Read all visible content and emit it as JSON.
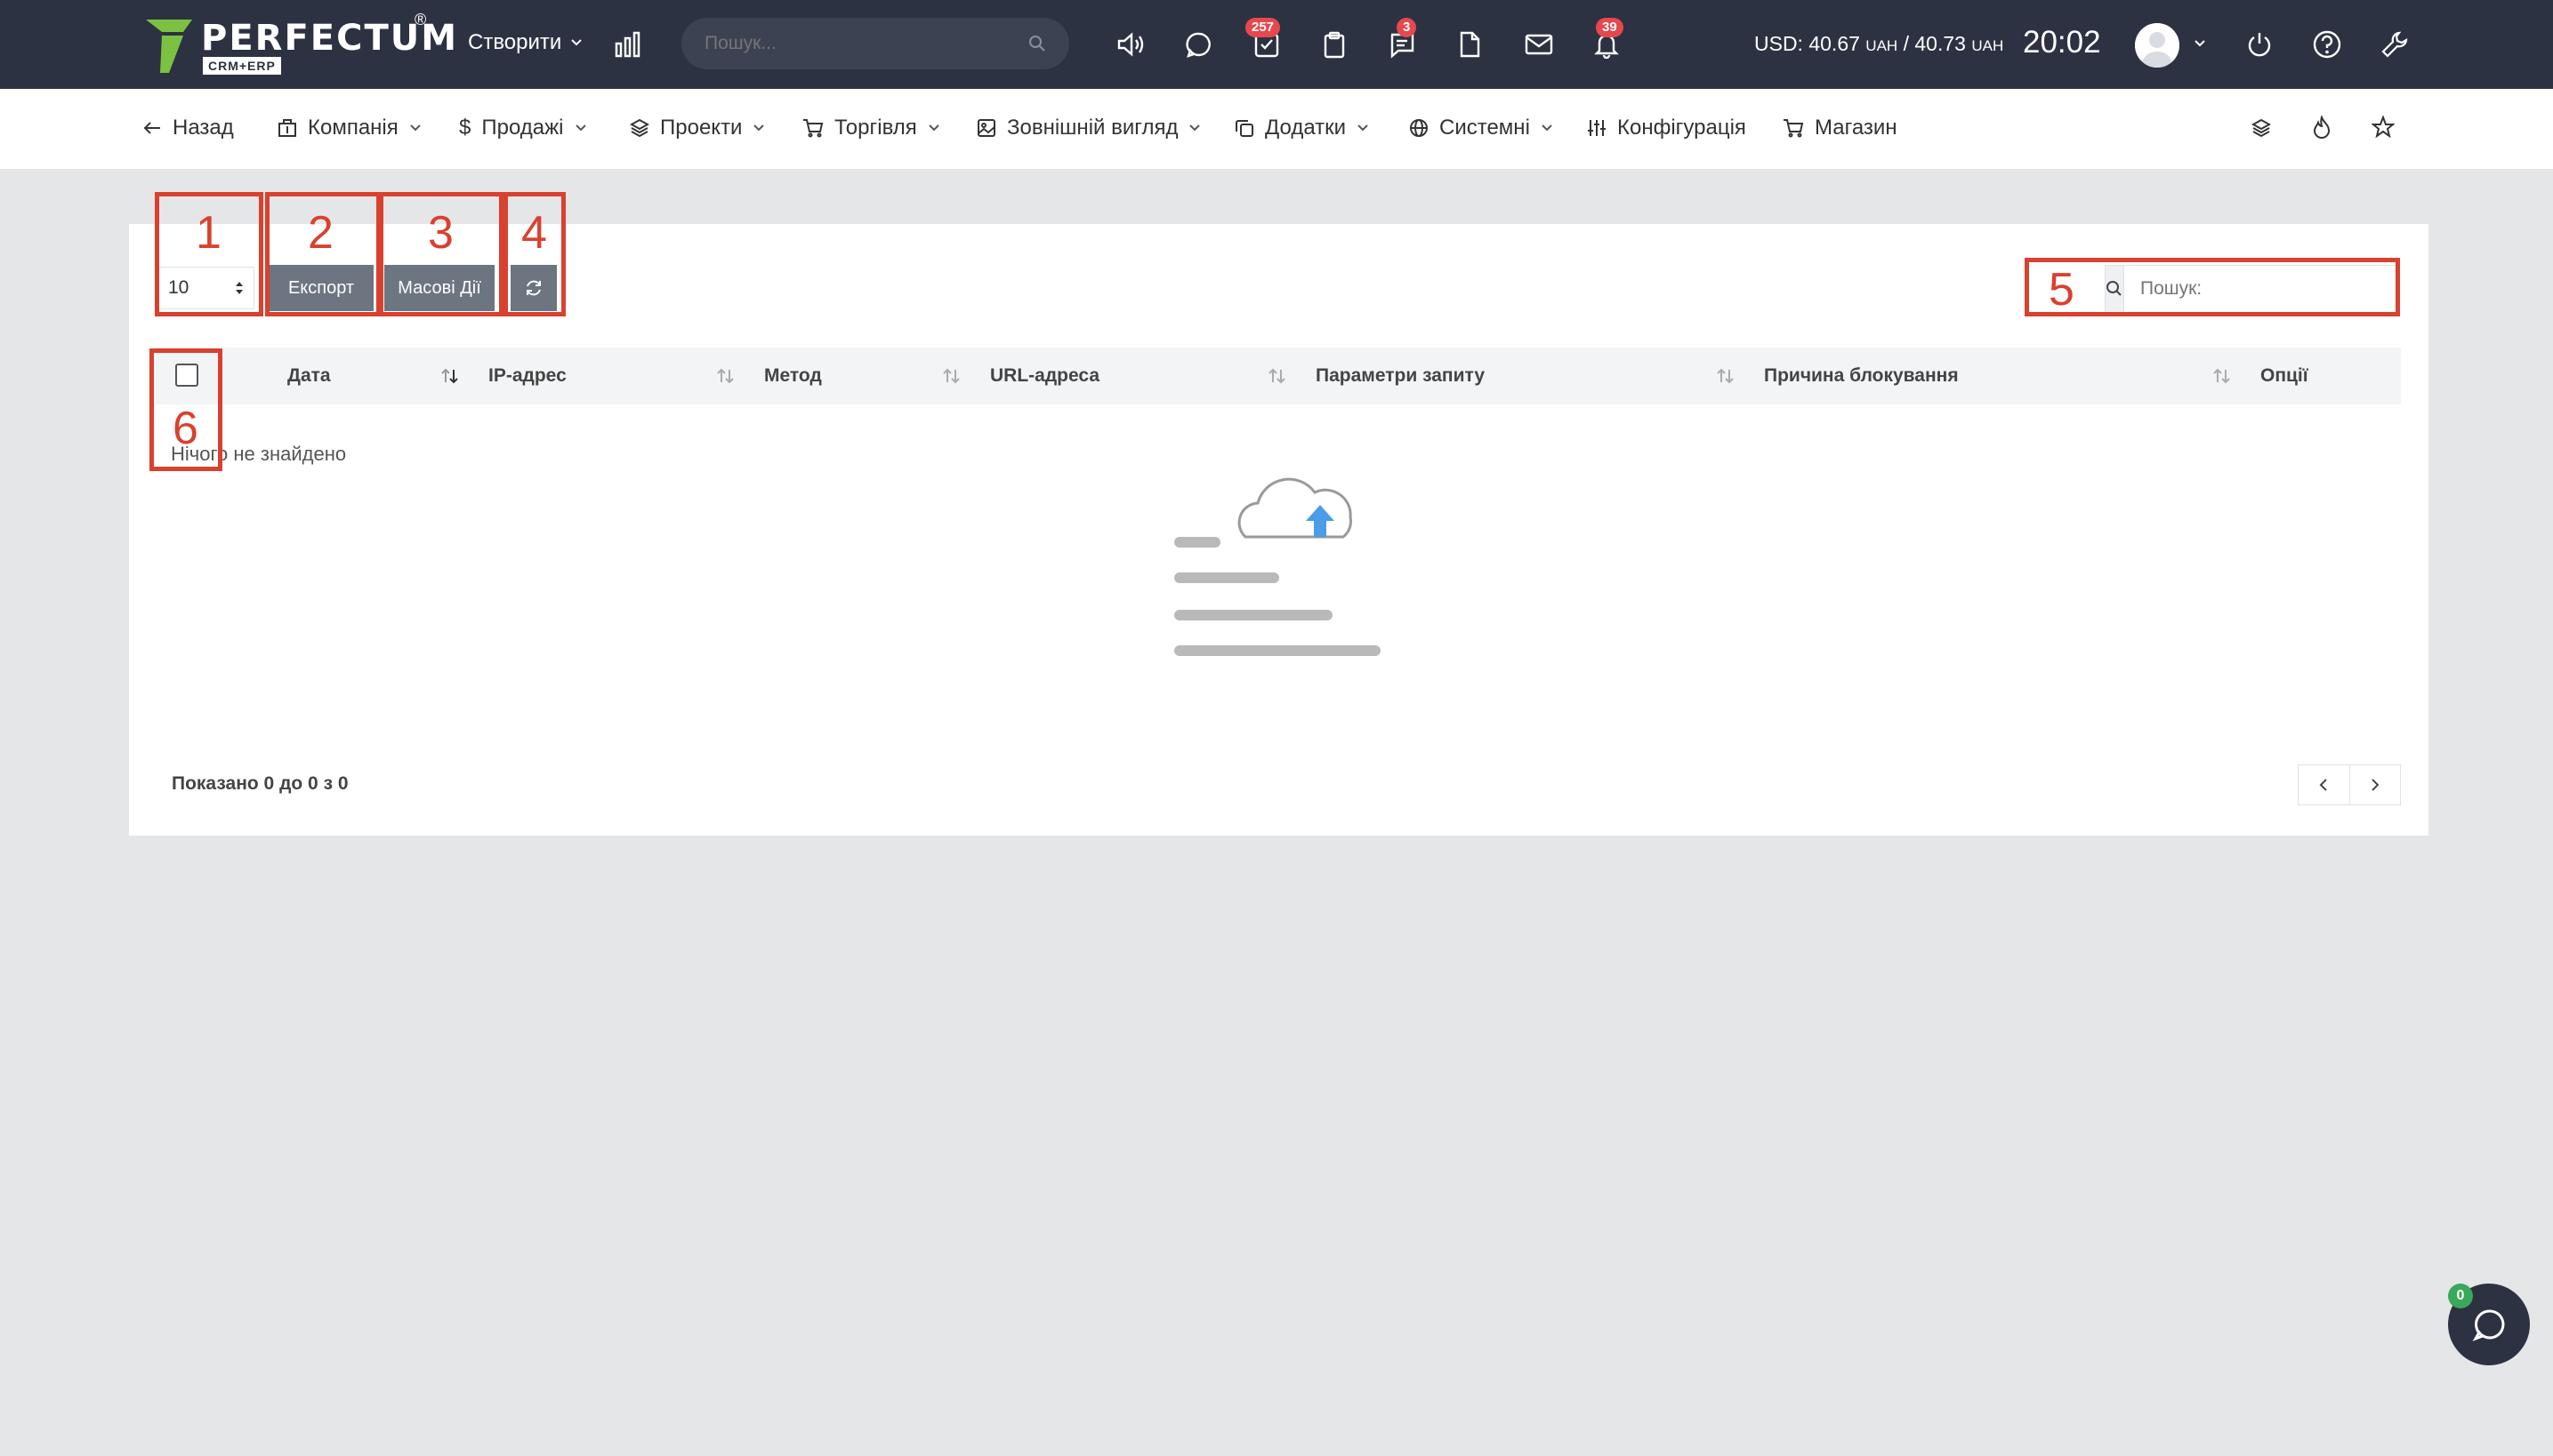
{
  "brand": {
    "name": "PERFECTUM",
    "sub": "CRM+ERP",
    "reg": "®"
  },
  "topbar": {
    "create_label": "Створити",
    "search_placeholder": "Пошук...",
    "badges": {
      "tasks": "257",
      "messages": "3",
      "notifications": "39"
    },
    "currency_text": "USD: 40.67",
    "currency_unit1": "UAH",
    "currency_sep": " / 40.73",
    "currency_unit2": "UAH",
    "clock": "20:02"
  },
  "nav": {
    "back": "Назад",
    "items": [
      "Компанія",
      "Продажі",
      "Проекти",
      "Торгівля",
      "Зовнішній вигляд",
      "Додатки",
      "Системні",
      "Конфігурація",
      "Магазин"
    ]
  },
  "table_controls": {
    "page_length": "10",
    "export_label": "Експорт",
    "bulk_label": "Масові Дії",
    "search_placeholder": "Пошук:"
  },
  "table": {
    "columns": [
      "Дата",
      "IP-адрес",
      "Метод",
      "URL-адреса",
      "Параметри запиту",
      "Причина блокування",
      "Опції"
    ],
    "empty_text": "Нічого не знайдено",
    "summary": "Показано 0 до 0 з 0"
  },
  "annotations": [
    "1",
    "2",
    "3",
    "4",
    "5",
    "6"
  ],
  "chat": {
    "badge": "0"
  },
  "colors": {
    "topbar": "#2c3241",
    "annotation": "#d9412f",
    "accent": "#4a9de6",
    "badge": "#e5484d"
  }
}
